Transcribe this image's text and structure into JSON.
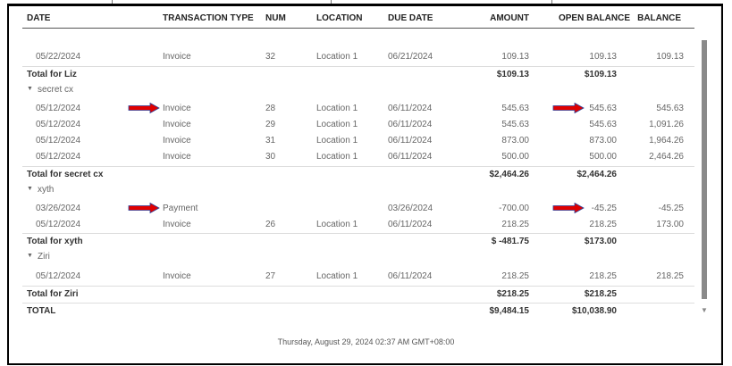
{
  "columns": [
    "DATE",
    "TRANSACTION TYPE",
    "NUM",
    "LOCATION",
    "DUE DATE",
    "AMOUNT",
    "OPEN BALANCE",
    "BALANCE"
  ],
  "rows": [
    {
      "kind": "data",
      "date": "05/22/2024",
      "type": "Invoice",
      "num": "32",
      "location": "Location 1",
      "due": "06/21/2024",
      "amount": "109.13",
      "open": "109.13",
      "balance": "109.13"
    },
    {
      "kind": "total",
      "label": "Total for Liz",
      "amount": "$109.13",
      "open": "$109.13"
    },
    {
      "kind": "group",
      "label": "secret cx"
    },
    {
      "kind": "data",
      "date": "05/12/2024",
      "type": "Invoice",
      "num": "28",
      "location": "Location 1",
      "due": "06/11/2024",
      "amount": "545.63",
      "open": "545.63",
      "balance": "545.63",
      "arrows": true
    },
    {
      "kind": "data",
      "date": "05/12/2024",
      "type": "Invoice",
      "num": "29",
      "location": "Location 1",
      "due": "06/11/2024",
      "amount": "545.63",
      "open": "545.63",
      "balance": "1,091.26"
    },
    {
      "kind": "data",
      "date": "05/12/2024",
      "type": "Invoice",
      "num": "31",
      "location": "Location 1",
      "due": "06/11/2024",
      "amount": "873.00",
      "open": "873.00",
      "balance": "1,964.26"
    },
    {
      "kind": "data",
      "date": "05/12/2024",
      "type": "Invoice",
      "num": "30",
      "location": "Location 1",
      "due": "06/11/2024",
      "amount": "500.00",
      "open": "500.00",
      "balance": "2,464.26"
    },
    {
      "kind": "total",
      "label": "Total for secret cx",
      "amount": "$2,464.26",
      "open": "$2,464.26"
    },
    {
      "kind": "group",
      "label": "xyth"
    },
    {
      "kind": "data",
      "date": "03/26/2024",
      "type": "Payment",
      "num": "",
      "location": "",
      "due": "03/26/2024",
      "amount": "-700.00",
      "open": "-45.25",
      "balance": "-45.25",
      "arrows": true
    },
    {
      "kind": "data",
      "date": "05/12/2024",
      "type": "Invoice",
      "num": "26",
      "location": "Location 1",
      "due": "06/11/2024",
      "amount": "218.25",
      "open": "218.25",
      "balance": "173.00"
    },
    {
      "kind": "total",
      "label": "Total for xyth",
      "amount": "$ -481.75",
      "open": "$173.00"
    },
    {
      "kind": "group",
      "label": "Ziri"
    },
    {
      "kind": "data",
      "date": "05/12/2024",
      "type": "Invoice",
      "num": "27",
      "location": "Location 1",
      "due": "06/11/2024",
      "amount": "218.25",
      "open": "218.25",
      "balance": "218.25"
    },
    {
      "kind": "total",
      "label": "Total for Ziri",
      "amount": "$218.25",
      "open": "$218.25"
    },
    {
      "kind": "total",
      "label": "TOTAL",
      "amount": "$9,484.15",
      "open": "$10,038.90"
    }
  ],
  "footer": "Thursday, August 29, 2024   02:37 AM GMT+08:00",
  "colors": {
    "arrow": "#e00000",
    "arrow_outline": "#2a3f9a"
  }
}
